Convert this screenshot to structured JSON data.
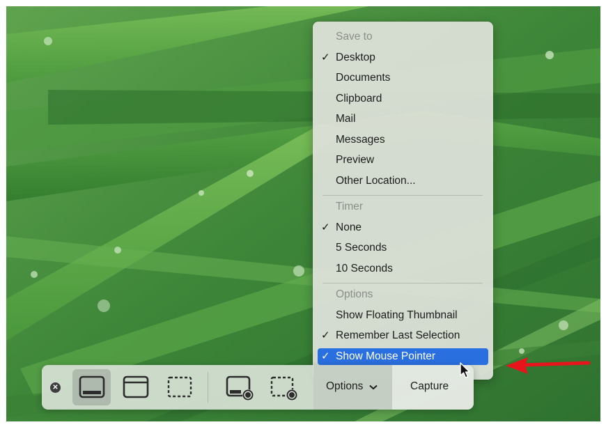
{
  "menu": {
    "save_to_header": "Save to",
    "save_to_items": [
      {
        "label": "Desktop",
        "checked": true
      },
      {
        "label": "Documents",
        "checked": false
      },
      {
        "label": "Clipboard",
        "checked": false
      },
      {
        "label": "Mail",
        "checked": false
      },
      {
        "label": "Messages",
        "checked": false
      },
      {
        "label": "Preview",
        "checked": false
      },
      {
        "label": "Other Location...",
        "checked": false
      }
    ],
    "timer_header": "Timer",
    "timer_items": [
      {
        "label": "None",
        "checked": true
      },
      {
        "label": "5 Seconds",
        "checked": false
      },
      {
        "label": "10 Seconds",
        "checked": false
      }
    ],
    "options_header": "Options",
    "options_items": [
      {
        "label": "Show Floating Thumbnail",
        "checked": false
      },
      {
        "label": "Remember Last Selection",
        "checked": true
      },
      {
        "label": "Show Mouse Pointer",
        "checked": true,
        "highlighted": true
      }
    ],
    "checkmark": "✓"
  },
  "toolbar": {
    "close_icon": "✕",
    "tools": [
      {
        "name": "capture-entire-screen",
        "selected": true
      },
      {
        "name": "capture-selected-window",
        "selected": false
      },
      {
        "name": "capture-selected-portion",
        "selected": false
      },
      {
        "name": "record-entire-screen",
        "selected": false
      },
      {
        "name": "record-selected-portion",
        "selected": false
      }
    ],
    "options_label": "Options",
    "capture_label": "Capture"
  },
  "colors": {
    "highlight": "#2a6fe0",
    "annotation_arrow": "#e8141b",
    "grass": "#3f8a3a"
  },
  "icons": [
    "close-icon",
    "entire-screen-icon",
    "window-icon",
    "selection-icon",
    "record-screen-icon",
    "record-selection-icon",
    "chevron-down-icon",
    "mouse-pointer-icon",
    "red-arrow-icon"
  ]
}
